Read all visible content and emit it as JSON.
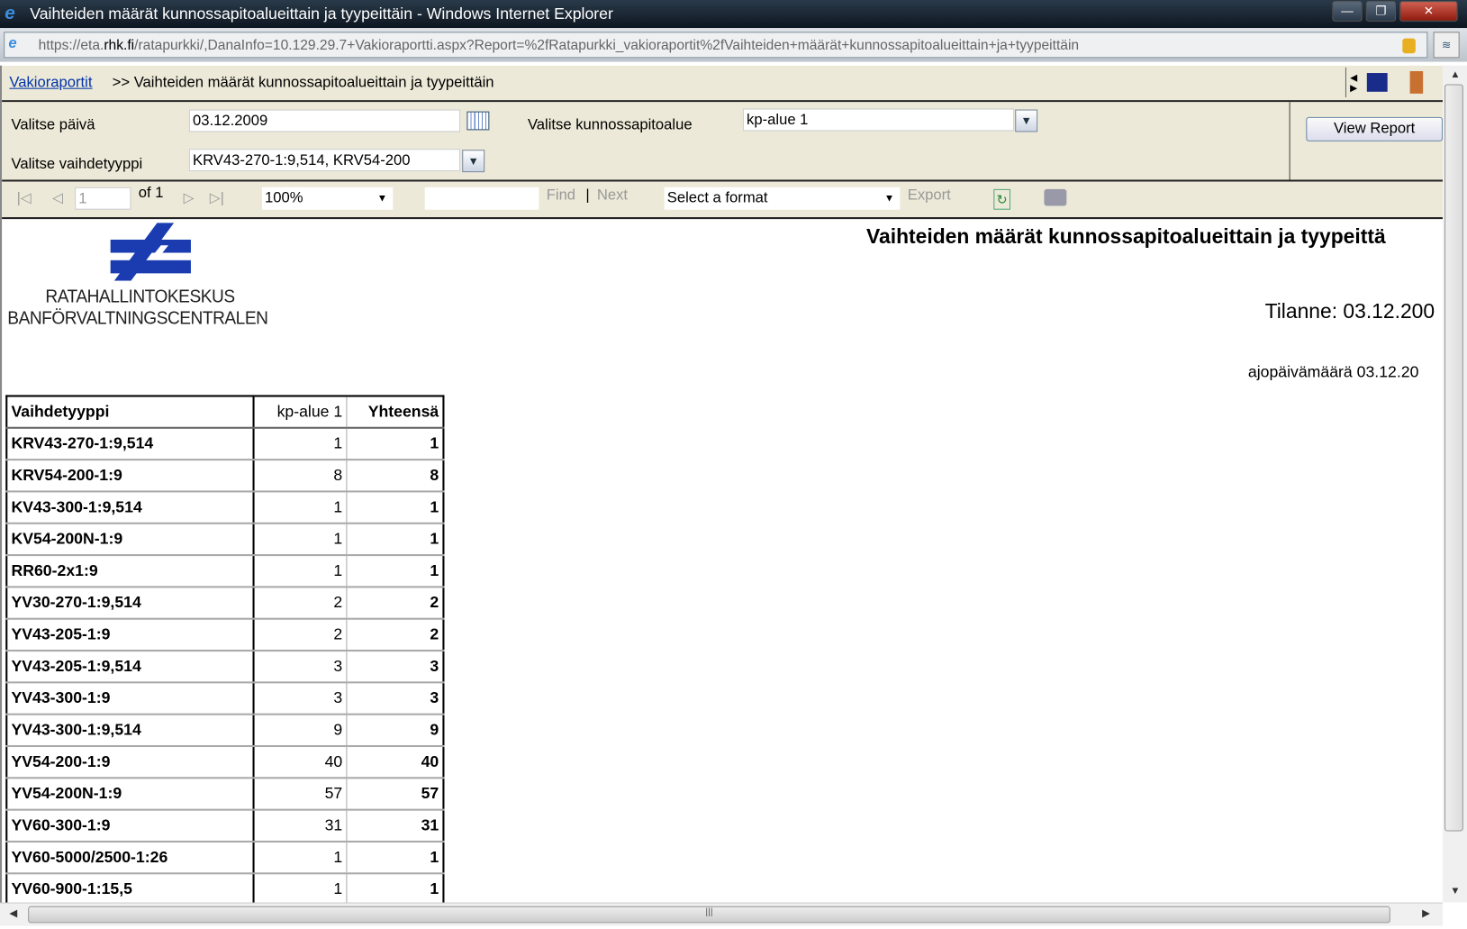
{
  "window": {
    "title": "Vaihteiden määrät kunnossapitoalueittain ja tyypeittäin - Windows Internet Explorer",
    "url_prefix": "https://eta.",
    "url_host": "rhk.fi",
    "url_rest": "/ratapurkki/,DanaInfo=10.129.29.7+Vakioraportti.aspx?Report=%2fRatapurkki_vakioraportit%2fVaihteiden+määrät+kunnossapitoalueittain+ja+tyypeittäin"
  },
  "breadcrumb": {
    "link": "Vakioraportit",
    "rest": ">> Vaihteiden määrät kunnossapitoalueittain ja tyypeittäin"
  },
  "params": {
    "date_label": "Valitse päivä",
    "date_value": "03.12.2009",
    "area_label": "Valitse kunnossapitoalue",
    "area_value": "kp-alue  1",
    "type_label": "Valitse vaihdetyyppi",
    "type_value": "KRV43-270-1:9,514, KRV54-200",
    "view_report": "View Report"
  },
  "toolbar": {
    "page": "1",
    "of": "of 1",
    "zoom": "100%",
    "find": "Find",
    "sep": "|",
    "next": "Next",
    "format": "Select a format",
    "export": "Export"
  },
  "report": {
    "logo_line1": "RATAHALLINTOKESKUS",
    "logo_line2": "BANFÖRVALTNINGSCENTRALEN",
    "title": "Vaihteiden määrät kunnossapitoalueittain ja tyypeittä",
    "status": "Tilanne: 03.12.200",
    "run_date": "ajopäivämäärä 03.12.20",
    "columns": [
      "Vaihdetyyppi",
      "kp-alue 1",
      "Yhteensä"
    ],
    "rows": [
      [
        "KRV43-270-1:9,514",
        "1",
        "1"
      ],
      [
        "KRV54-200-1:9",
        "8",
        "8"
      ],
      [
        "KV43-300-1:9,514",
        "1",
        "1"
      ],
      [
        "KV54-200N-1:9",
        "1",
        "1"
      ],
      [
        "RR60-2x1:9",
        "1",
        "1"
      ],
      [
        "YV30-270-1:9,514",
        "2",
        "2"
      ],
      [
        "YV43-205-1:9",
        "2",
        "2"
      ],
      [
        "YV43-205-1:9,514",
        "3",
        "3"
      ],
      [
        "YV43-300-1:9",
        "3",
        "3"
      ],
      [
        "YV43-300-1:9,514",
        "9",
        "9"
      ],
      [
        "YV54-200-1:9",
        "40",
        "40"
      ],
      [
        "YV54-200N-1:9",
        "57",
        "57"
      ],
      [
        "YV60-300-1:9",
        "31",
        "31"
      ],
      [
        "YV60-5000/2500-1:26",
        "1",
        "1"
      ],
      [
        "YV60-900-1:15,5",
        "1",
        "1"
      ]
    ]
  },
  "colors": {
    "logo": "#1a3cb0",
    "link": "#0033aa",
    "panel": "#ece9d8"
  }
}
